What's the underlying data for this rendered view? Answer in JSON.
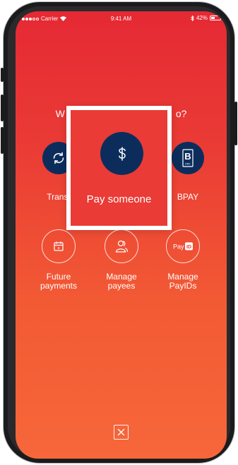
{
  "status_bar": {
    "carrier": "Carrier",
    "time": "9:41 AM",
    "battery": "42%",
    "battery_level": 0.42
  },
  "prompt": {
    "question_start": "W",
    "question_end": "o?"
  },
  "options": {
    "transfer": {
      "label": "Transf",
      "icon": "transfer-arrows-icon"
    },
    "pay_someone": {
      "label": "Pay someone",
      "icon": "dollar-icon"
    },
    "bpay": {
      "label": "BPAY",
      "icon": "bpay-logo-icon"
    },
    "future_payments": {
      "label_line1": "Future",
      "label_line2": "payments",
      "icon": "calendar-icon"
    },
    "manage_payees": {
      "label_line1": "Manage",
      "label_line2": "payees",
      "icon": "people-icon"
    },
    "manage_payids": {
      "label_line1": "Manage",
      "label_line2": "PayIDs",
      "icon": "payid-logo-icon",
      "icon_text": "Pay",
      "icon_badge": "ID"
    }
  },
  "colors": {
    "gradient_top": "#e52934",
    "gradient_bottom": "#f7673a",
    "navy": "#0c2d5c",
    "white": "#ffffff"
  },
  "close": {
    "icon": "close-icon"
  }
}
